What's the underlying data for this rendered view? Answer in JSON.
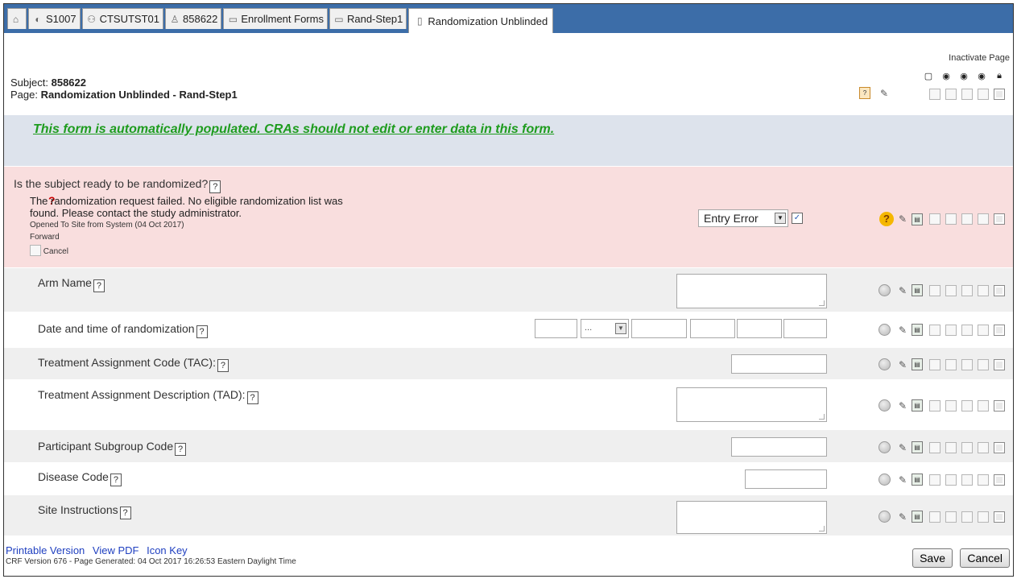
{
  "tabs": [
    {
      "label": "",
      "icon": "home-icon"
    },
    {
      "label": "S1007",
      "icon": "study-icon"
    },
    {
      "label": "CTSUTST01",
      "icon": "site-icon"
    },
    {
      "label": "858622",
      "icon": "person-icon"
    },
    {
      "label": "Enrollment Forms",
      "icon": "folder-icon"
    },
    {
      "label": "Rand-Step1",
      "icon": "folder-icon"
    },
    {
      "label": "Randomization Unblinded",
      "icon": "page-icon"
    }
  ],
  "header": {
    "subject_label": "Subject:",
    "subject_value": "858622",
    "page_label": "Page:",
    "page_value": "Randomization Unblinded - Rand-Step1",
    "inactivate_label": "Inactivate Page"
  },
  "banner": "This form is automatically populated. CRAs should not edit or enter data in this form.",
  "ready_question": {
    "label": "Is the subject ready to be randomized?",
    "query_text_1": "The randomization request failed. No eligible randomization list was",
    "query_text_2": "found. Please contact the study administrator.",
    "opened": "Opened To Site from System (04 Oct 2017)",
    "forward": "Forward",
    "cancel": "Cancel",
    "response": "Entry Error"
  },
  "questions": {
    "arm_name": "Arm Name",
    "date_time": "Date and time of randomization",
    "date_month_placeholder": "...",
    "tac": "Treatment Assignment Code (TAC):",
    "tad": "Treatment Assignment Description (TAD):",
    "subgroup": "Participant Subgroup Code",
    "disease": "Disease Code",
    "site_instructions": "Site Instructions"
  },
  "footer": {
    "printable": "Printable Version",
    "view_pdf": "View PDF",
    "icon_key": "Icon Key",
    "crf": "CRF Version 676 - Page Generated: 04 Oct 2017 16:26:53 Eastern Daylight Time",
    "save": "Save",
    "cancel": "Cancel"
  },
  "colors": {
    "tabbar": "#3c6da8",
    "banner_bg": "#dde3ec",
    "banner_text": "#1e9c1e",
    "query_row": "#f9dede"
  }
}
